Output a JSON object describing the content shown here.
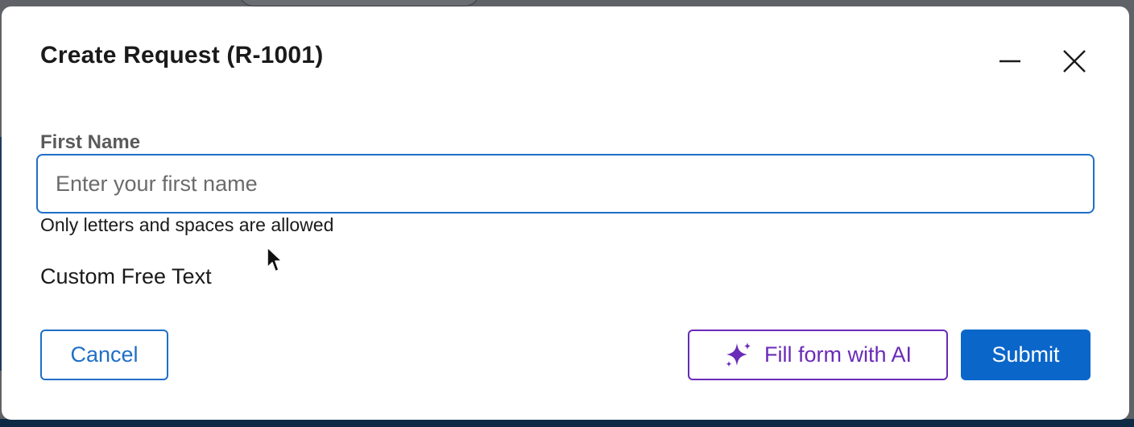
{
  "modal": {
    "title": "Create Request (R-1001)",
    "minimize_icon": "minimize-icon",
    "close_icon": "close-icon"
  },
  "form": {
    "first_name": {
      "label": "First Name",
      "value": "",
      "placeholder": "Enter your first name",
      "helper": "Only letters and spaces are allowed"
    },
    "free_text": "Custom Free Text"
  },
  "actions": {
    "cancel_label": "Cancel",
    "ai_label": "Fill form with AI",
    "ai_icon": "sparkle-icon",
    "submit_label": "Submit"
  },
  "colors": {
    "primary": "#0b66c9",
    "ai_accent": "#6a2bb8",
    "overlay": "#5f6266"
  }
}
